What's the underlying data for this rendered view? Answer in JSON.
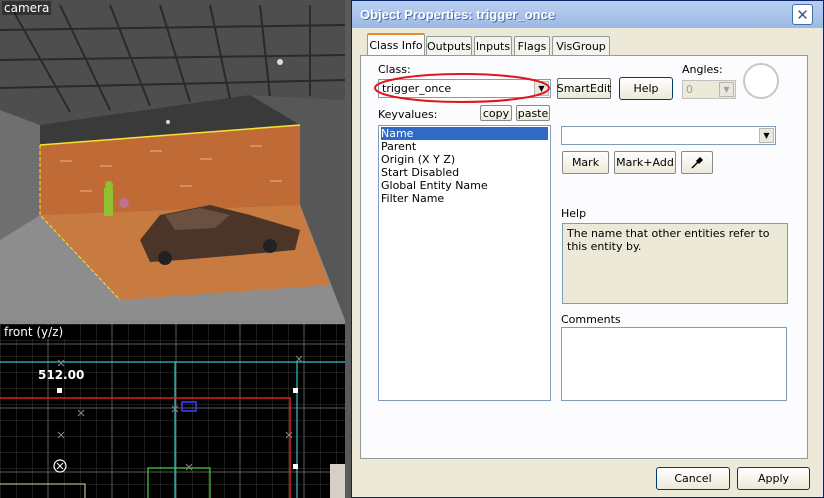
{
  "viewports": {
    "camera_label": "camera",
    "front_label": "front (y/z)",
    "coordinate_label": "512.00"
  },
  "dialog": {
    "title": "Object Properties: trigger_once",
    "tabs": [
      {
        "label": "Class Info",
        "active": true
      },
      {
        "label": "Outputs"
      },
      {
        "label": "Inputs"
      },
      {
        "label": "Flags"
      },
      {
        "label": "VisGroup"
      }
    ],
    "class_label": "Class:",
    "class_value": "trigger_once",
    "smartedit_label": "SmartEdit",
    "help_button_label": "Help",
    "angles_label": "Angles:",
    "angles_value": "0",
    "keyvalues_label": "Keyvalues:",
    "copy_label": "copy",
    "paste_label": "paste",
    "keyvalues": [
      "Name",
      "Parent",
      "Origin (X Y Z)",
      "Start Disabled",
      "Global Entity Name",
      "Filter Name"
    ],
    "selected_keyvalue": "Name",
    "value_field": "",
    "mark_label": "Mark",
    "mark_add_label": "Mark+Add",
    "help_section_label": "Help",
    "help_text": "The name that other entities refer to this entity by.",
    "comments_label": "Comments",
    "cancel_label": "Cancel",
    "apply_label": "Apply",
    "colors": {
      "highlight_ellipse": "#e0141c",
      "selection": "#316ac5",
      "title_gradient": "#9cb9e6"
    }
  }
}
